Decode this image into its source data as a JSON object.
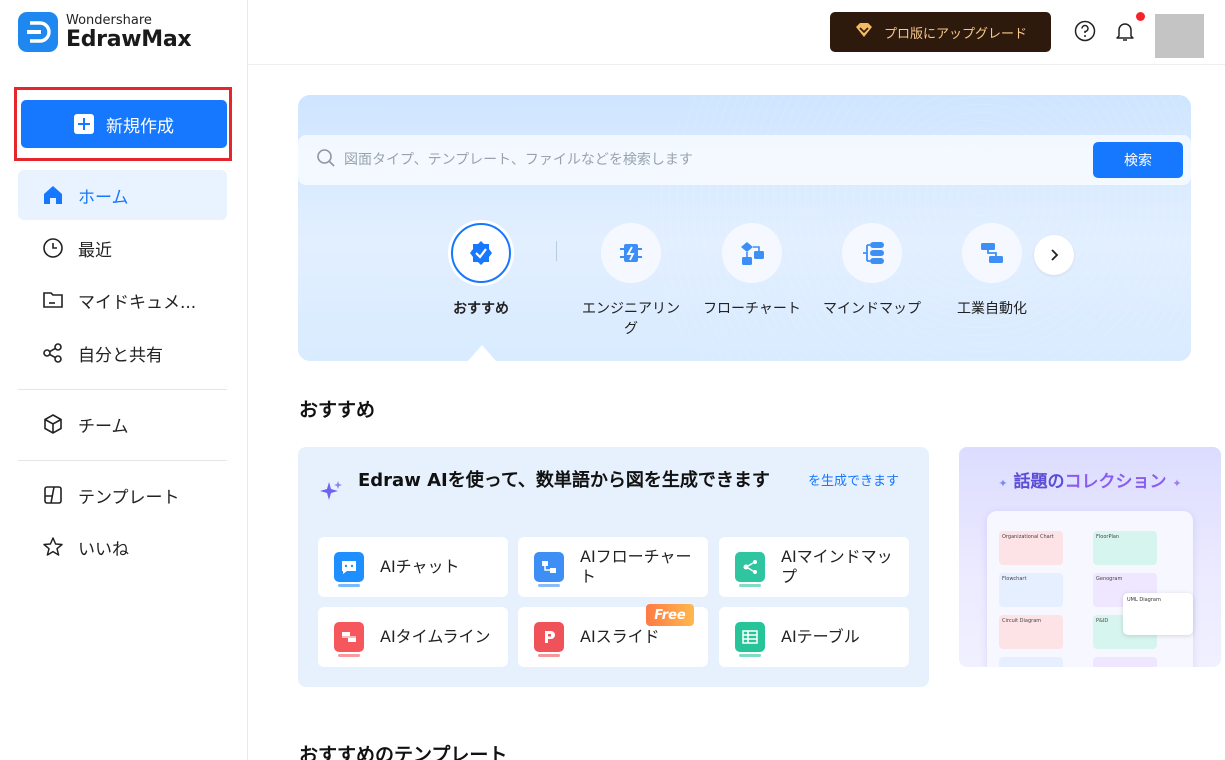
{
  "brand": {
    "company": "Wondershare",
    "product": "EdrawMax"
  },
  "sidebar": {
    "new_button": "新規作成",
    "items": [
      {
        "label": "ホーム",
        "icon": "home-icon"
      },
      {
        "label": "最近",
        "icon": "clock-icon"
      },
      {
        "label": "マイドキュメ...",
        "icon": "folder-icon"
      },
      {
        "label": "自分と共有",
        "icon": "share-icon"
      },
      {
        "label": "チーム",
        "icon": "cube-icon"
      },
      {
        "label": "テンプレート",
        "icon": "template-icon"
      },
      {
        "label": "いいね",
        "icon": "star-icon"
      }
    ]
  },
  "header": {
    "upgrade_label": "プロ版にアップグレード"
  },
  "search": {
    "placeholder": "図面タイプ、テンプレート、ファイルなどを検索します",
    "button": "検索"
  },
  "categories": [
    {
      "label": "おすすめ"
    },
    {
      "label": "エンジニアリング"
    },
    {
      "label": "フローチャート"
    },
    {
      "label": "マインドマップ"
    },
    {
      "label": "工業自動化"
    }
  ],
  "recommend_title": "おすすめ",
  "ai": {
    "title": "Edraw AIを使って、数単語から図を生成できます",
    "link": "を生成できます",
    "free_badge": "Free",
    "tools": [
      {
        "label": "AIチャット",
        "color": "#1e8fff"
      },
      {
        "label": "AIフローチャート",
        "color": "#3d8ff5"
      },
      {
        "label": "AIマインドマップ",
        "color": "#2ec5a0"
      },
      {
        "label": "AIタイムライン",
        "color": "#f5575c"
      },
      {
        "label": "AIスライド",
        "color": "#f0525a"
      },
      {
        "label": "AIテーブル",
        "color": "#27c49a"
      }
    ]
  },
  "collection": {
    "title_prefix": "話題の",
    "title_highlight": "コレクション",
    "thumbs": [
      "Organizational Chart",
      "FloorPlan",
      "Flowchart",
      "Genogram",
      "Circuit Diagram",
      "P&ID",
      "UML Diagram"
    ]
  },
  "templates_title": "おすすめのテンプレート"
}
